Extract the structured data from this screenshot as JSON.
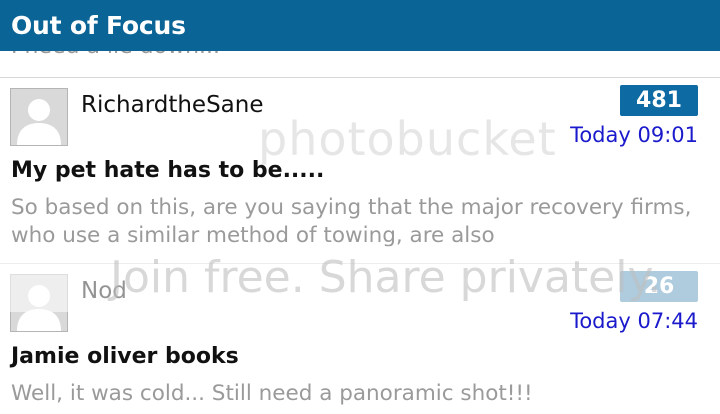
{
  "header": {
    "title": "Out of Focus"
  },
  "list": {
    "clipped_preview": "I need a lie down...",
    "threads": [
      {
        "author": "RichardtheSane",
        "replies": "481",
        "timestamp": "Today 09:01",
        "title": "My pet hate has to be.....",
        "preview": "So based on this, are you saying that the major recovery firms, who use a similar method of towing, are also"
      },
      {
        "author": "Nod",
        "replies": "26",
        "timestamp": "Today 07:44",
        "title": "Jamie oliver books",
        "preview": "Well, it was cold... Still need a panoramic shot!!!"
      }
    ]
  },
  "watermark": {
    "logo_text": "photobucket",
    "banner_text": "Join free. Share privately."
  },
  "colors": {
    "header_bg": "#0a6496",
    "badge_bg": "#0e6aa3",
    "timestamp": "#1a1acc",
    "preview_text": "#9a9a9a"
  },
  "icons": {
    "avatar": "default-user-avatar-icon"
  }
}
